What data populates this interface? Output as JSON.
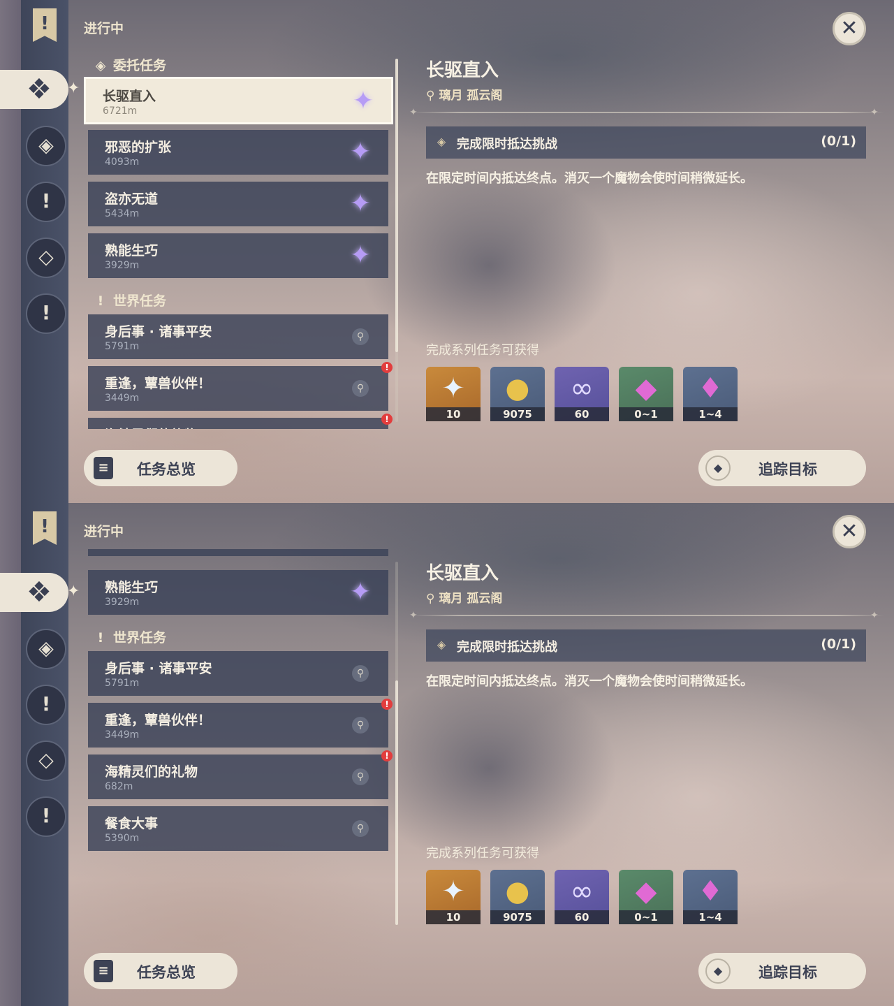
{
  "status_title": "进行中",
  "close_symbol": "✕",
  "sections": {
    "commission": "委托任务",
    "world": "世界任务"
  },
  "quests": {
    "q1": {
      "name": "长驱直入",
      "distance": "6721m"
    },
    "q2": {
      "name": "邪恶的扩张",
      "distance": "4093m"
    },
    "q3": {
      "name": "盗亦无道",
      "distance": "5434m"
    },
    "q4": {
      "name": "熟能生巧",
      "distance": "3929m"
    },
    "q5": {
      "name": "身后事 · 诸事平安",
      "distance": "5791m"
    },
    "q6": {
      "name": "重逢，蕈兽伙伴！",
      "distance": "3449m"
    },
    "q7": {
      "name": "海精灵们的礼物",
      "distance": "682m"
    },
    "q8": {
      "name": "餐食大事",
      "distance": "5390m"
    }
  },
  "detail": {
    "title": "长驱直入",
    "location": "璃月 孤云阁",
    "objective": "完成限时抵达挑战",
    "progress": "(0/1)",
    "description": "在限定时间内抵达终点。消灭一个魔物会使时间稍微延长。",
    "rewards_label": "完成系列任务可获得",
    "rewards": [
      {
        "icon": "primogem-icon",
        "count": "10"
      },
      {
        "icon": "mora-icon",
        "count": "9075"
      },
      {
        "icon": "adventure-exp-icon",
        "count": "60"
      },
      {
        "icon": "crystal-chunk-icon",
        "count": "0~1"
      },
      {
        "icon": "crystal-cluster-icon",
        "count": "1~4"
      }
    ]
  },
  "buttons": {
    "overview": "任务总览",
    "track": "追踪目标"
  }
}
